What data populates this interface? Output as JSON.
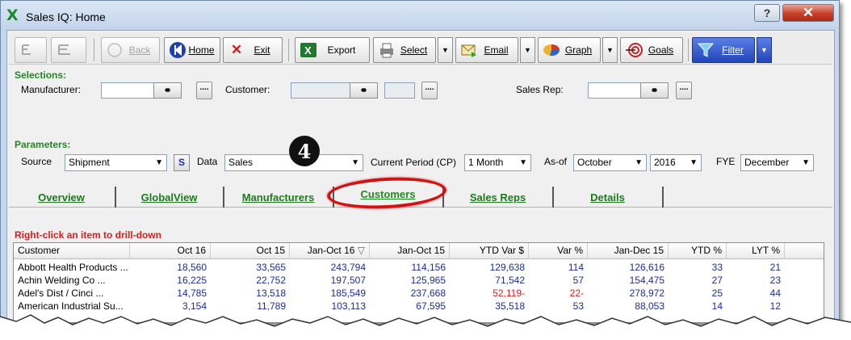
{
  "window": {
    "title": "Sales IQ: Home",
    "app_icon": "X",
    "help_label": "?",
    "close_label": "✕"
  },
  "toolbar": {
    "back_label": "Back",
    "home_label": "Home",
    "exit_label": "Exit",
    "export_label": "Export",
    "select_label": "Select",
    "email_label": "Email",
    "graph_label": "Graph",
    "goals_label": "Goals",
    "filter_label": "Filter"
  },
  "selections": {
    "heading": "Selections:",
    "manufacturer_label": "Manufacturer:",
    "customer_label": "Customer:",
    "sales_rep_label": "Sales Rep:",
    "dots_label": "...."
  },
  "parameters": {
    "heading": "Parameters:",
    "source_label": "Source",
    "source_value": "Shipment",
    "s_button": "S",
    "data_label": "Data",
    "data_value": "Sales",
    "current_period_label": "Current Period (CP)",
    "current_period_value": "1 Month",
    "as_of_label": "As-of",
    "as_of_month": "October",
    "as_of_year": "2016",
    "fye_label": "FYE",
    "fye_value": "December"
  },
  "tabs": [
    "Overview",
    "GlobalView",
    "Manufacturers",
    "Customers",
    "Sales Reps",
    "Details"
  ],
  "active_tab": "Customers",
  "callout_number": "4",
  "drill_hint": "Right-click an item to drill-down",
  "grid": {
    "columns": [
      "Customer",
      "Oct 16",
      "Oct 15",
      "Jan-Oct 16",
      "Jan-Oct 15",
      "YTD Var $",
      "Var %",
      "Jan-Dec 15",
      "YTD %",
      "LYT %"
    ],
    "sort_indicator": "▽",
    "rows": [
      [
        "Abbott Health Products ...",
        "18,560",
        "33,565",
        "243,794",
        "114,156",
        "129,638",
        "114",
        "126,616",
        "33",
        "21"
      ],
      [
        "Achin Welding Co         ...",
        "16,225",
        "22,752",
        "197,507",
        "125,965",
        "71,542",
        "57",
        "154,475",
        "27",
        "23"
      ],
      [
        "Adel's Dist / Cinci       ...",
        "14,785",
        "13,518",
        "185,549",
        "237,668",
        "52,119-",
        "22-",
        "278,972",
        "25",
        "44"
      ],
      [
        "American Industrial Su...",
        "3,154",
        "11,789",
        "103,113",
        "67,595",
        "35,518",
        "53",
        "88,053",
        "14",
        "12"
      ]
    ]
  }
}
